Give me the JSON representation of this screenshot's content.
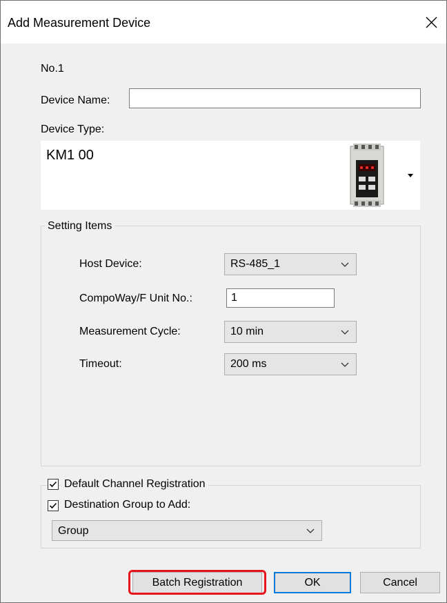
{
  "window": {
    "title": "Add Measurement Device"
  },
  "no_label": "No.1",
  "device_name": {
    "label": "Device Name:",
    "value": ""
  },
  "device_type": {
    "label": "Device Type:",
    "value": "KM1 00",
    "image": "device-module-icon"
  },
  "settings": {
    "legend": "Setting Items",
    "host_device": {
      "label": "Host Device:",
      "value": "RS-485_1"
    },
    "unit_no": {
      "label": "CompoWay/F Unit No.:",
      "value": "1"
    },
    "cycle": {
      "label": "Measurement Cycle:",
      "value": "10 min"
    },
    "timeout": {
      "label": "Timeout:",
      "value": "200 ms"
    }
  },
  "options": {
    "default_channel": {
      "label": "Default Channel Registration",
      "checked": true
    },
    "destination_group": {
      "label": "Destination Group to Add:",
      "checked": true
    },
    "group_value": "Group"
  },
  "buttons": {
    "batch": "Batch Registration",
    "ok": "OK",
    "cancel": "Cancel"
  },
  "colors": {
    "highlight": "#e8141c",
    "accent": "#0078d7"
  }
}
